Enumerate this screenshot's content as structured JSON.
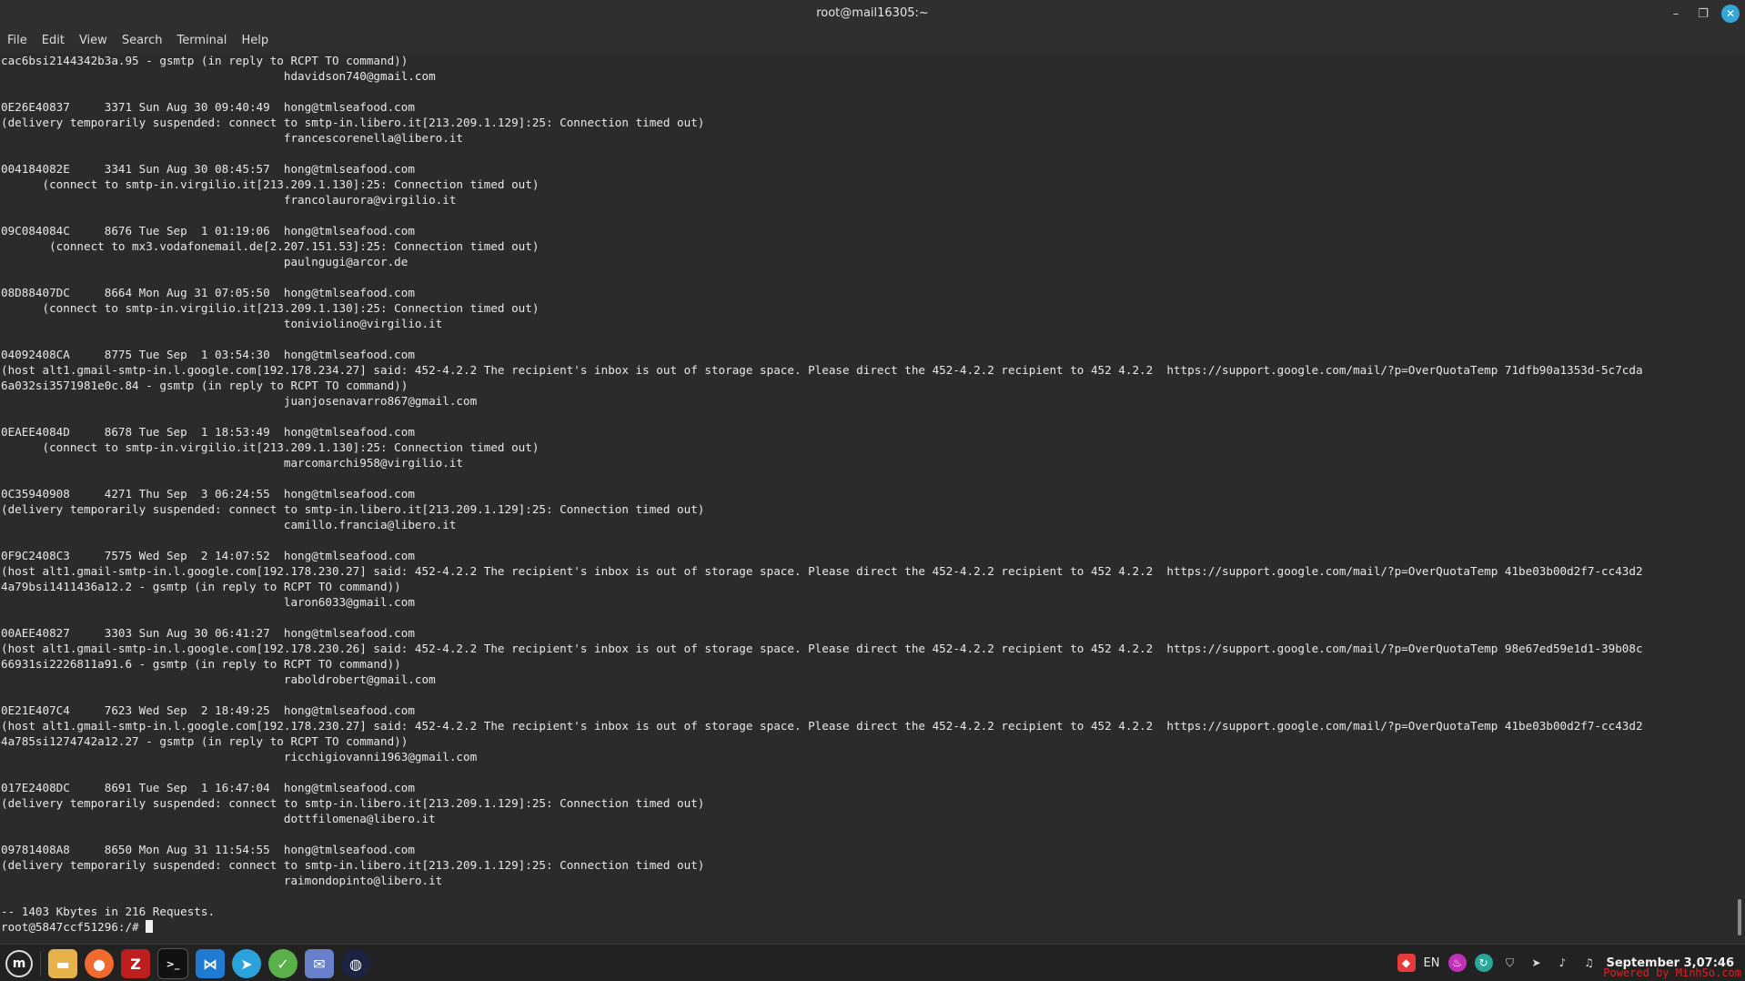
{
  "window": {
    "title": "root@mail16305:~"
  },
  "menu": [
    "File",
    "Edit",
    "View",
    "Search",
    "Terminal",
    "Help"
  ],
  "terminal_lines": [
    "cac6bsi2144342b3a.95 - gsmtp (in reply to RCPT TO command))",
    "                                         hdavidson740@gmail.com",
    "",
    "0E26E40837     3371 Sun Aug 30 09:40:49  hong@tmlseafood.com",
    "(delivery temporarily suspended: connect to smtp-in.libero.it[213.209.1.129]:25: Connection timed out)",
    "                                         francescorenella@libero.it",
    "",
    "004184082E     3341 Sun Aug 30 08:45:57  hong@tmlseafood.com",
    "      (connect to smtp-in.virgilio.it[213.209.1.130]:25: Connection timed out)",
    "                                         francolaurora@virgilio.it",
    "",
    "09C084084C     8676 Tue Sep  1 01:19:06  hong@tmlseafood.com",
    "       (connect to mx3.vodafonemail.de[2.207.151.53]:25: Connection timed out)",
    "                                         paulngugi@arcor.de",
    "",
    "08D88407DC     8664 Mon Aug 31 07:05:50  hong@tmlseafood.com",
    "      (connect to smtp-in.virgilio.it[213.209.1.130]:25: Connection timed out)",
    "                                         toniviolino@virgilio.it",
    "",
    "04092408CA     8775 Tue Sep  1 03:54:30  hong@tmlseafood.com",
    "(host alt1.gmail-smtp-in.l.google.com[192.178.234.27] said: 452-4.2.2 The recipient's inbox is out of storage space. Please direct the 452-4.2.2 recipient to 452 4.2.2  https://support.google.com/mail/?p=OverQuotaTemp 71dfb90a1353d-5c7cda",
    "6a032si3571981e0c.84 - gsmtp (in reply to RCPT TO command))",
    "                                         juanjosenavarro867@gmail.com",
    "",
    "0EAEE4084D     8678 Tue Sep  1 18:53:49  hong@tmlseafood.com",
    "      (connect to smtp-in.virgilio.it[213.209.1.130]:25: Connection timed out)",
    "                                         marcomarchi958@virgilio.it",
    "",
    "0C35940908     4271 Thu Sep  3 06:24:55  hong@tmlseafood.com",
    "(delivery temporarily suspended: connect to smtp-in.libero.it[213.209.1.129]:25: Connection timed out)",
    "                                         camillo.francia@libero.it",
    "",
    "0F9C2408C3     7575 Wed Sep  2 14:07:52  hong@tmlseafood.com",
    "(host alt1.gmail-smtp-in.l.google.com[192.178.230.27] said: 452-4.2.2 The recipient's inbox is out of storage space. Please direct the 452-4.2.2 recipient to 452 4.2.2  https://support.google.com/mail/?p=OverQuotaTemp 41be03b00d2f7-cc43d2",
    "4a79bsi1411436a12.2 - gsmtp (in reply to RCPT TO command))",
    "                                         laron6033@gmail.com",
    "",
    "00AEE40827     3303 Sun Aug 30 06:41:27  hong@tmlseafood.com",
    "(host alt1.gmail-smtp-in.l.google.com[192.178.230.26] said: 452-4.2.2 The recipient's inbox is out of storage space. Please direct the 452-4.2.2 recipient to 452 4.2.2  https://support.google.com/mail/?p=OverQuotaTemp 98e67ed59e1d1-39b08c",
    "66931si2226811a91.6 - gsmtp (in reply to RCPT TO command))",
    "                                         raboldrobert@gmail.com",
    "",
    "0E21E407C4     7623 Wed Sep  2 18:49:25  hong@tmlseafood.com",
    "(host alt1.gmail-smtp-in.l.google.com[192.178.230.27] said: 452-4.2.2 The recipient's inbox is out of storage space. Please direct the 452-4.2.2 recipient to 452 4.2.2  https://support.google.com/mail/?p=OverQuotaTemp 41be03b00d2f7-cc43d2",
    "4a785si1274742a12.27 - gsmtp (in reply to RCPT TO command))",
    "                                         ricchigiovanni1963@gmail.com",
    "",
    "017E2408DC     8691 Tue Sep  1 16:47:04  hong@tmlseafood.com",
    "(delivery temporarily suspended: connect to smtp-in.libero.it[213.209.1.129]:25: Connection timed out)",
    "                                         dottfilomena@libero.it",
    "",
    "09781408A8     8650 Mon Aug 31 11:54:55  hong@tmlseafood.com",
    "(delivery temporarily suspended: connect to smtp-in.libero.it[213.209.1.129]:25: Connection timed out)",
    "                                         raimondopinto@libero.it",
    "",
    "-- 1403 Kbytes in 216 Requests."
  ],
  "prompt": "root@5847ccf51296:/# ",
  "taskbar": {
    "apps": [
      "mint-menu-icon",
      "files-icon",
      "firefox-icon",
      "filezilla-icon",
      "terminal-icon",
      "vscode-icon",
      "telegram-icon",
      "app-green-icon",
      "mail-icon",
      "app-dark-icon"
    ],
    "keyboard_layout": "EN",
    "clock": "September  3,07:46"
  },
  "watermark": "Powered by MinhSo.com"
}
